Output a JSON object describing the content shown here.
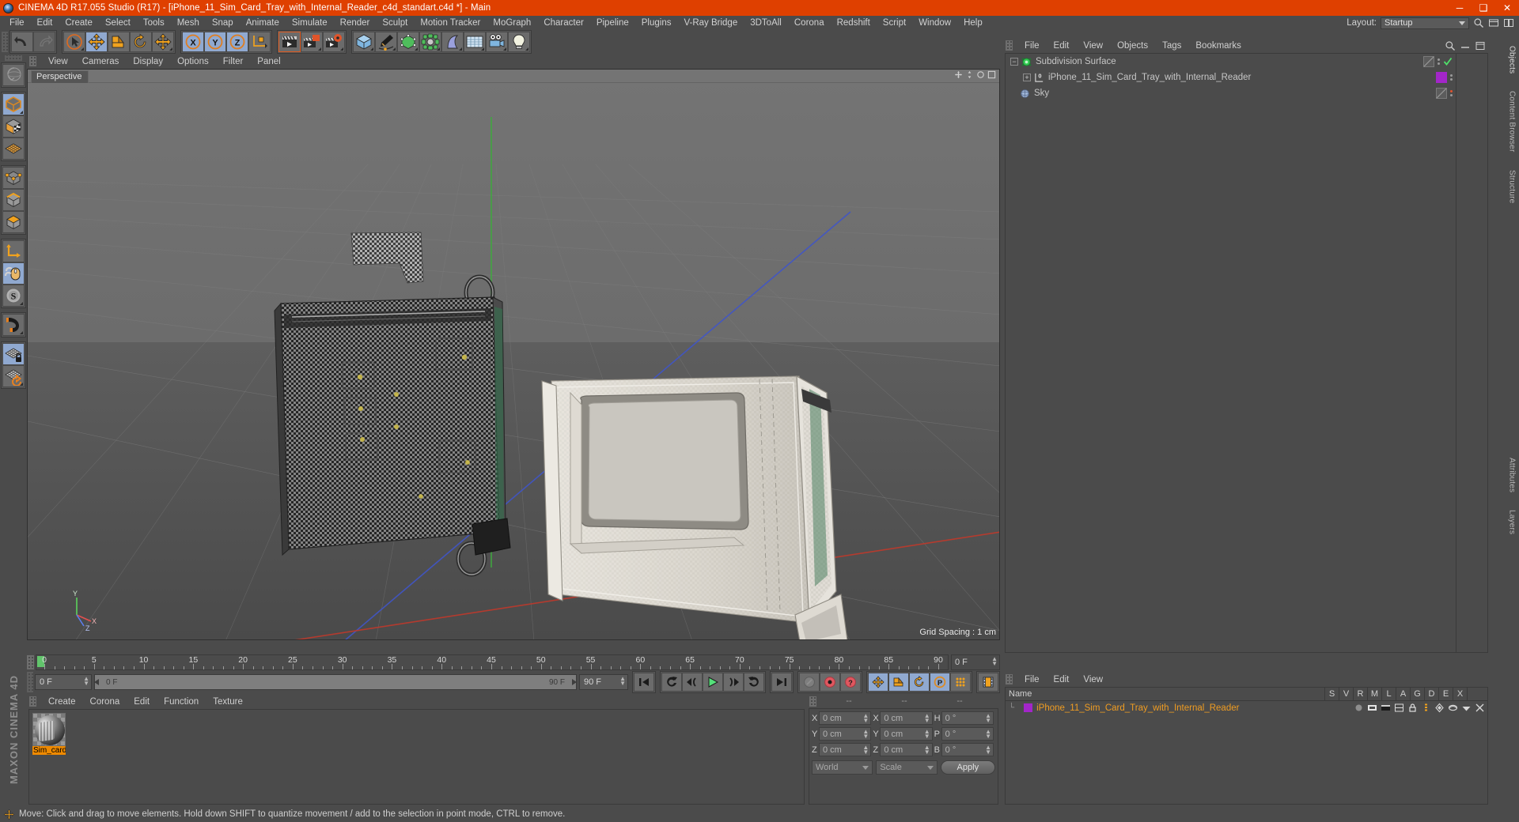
{
  "titlebar": {
    "title": "CINEMA 4D R17.055 Studio (R17) - [iPhone_11_Sim_Card_Tray_with_Internal_Reader_c4d_standart.c4d *] - Main",
    "minimize": "─",
    "maximize": "❑",
    "close": "✕",
    "accent_color": "#df4000"
  },
  "menubar": {
    "items": [
      {
        "label": "File"
      },
      {
        "label": "Edit"
      },
      {
        "label": "Create"
      },
      {
        "label": "Select"
      },
      {
        "label": "Tools"
      },
      {
        "label": "Mesh"
      },
      {
        "label": "Snap"
      },
      {
        "label": "Animate"
      },
      {
        "label": "Simulate"
      },
      {
        "label": "Render"
      },
      {
        "label": "Sculpt"
      },
      {
        "label": "Motion Tracker"
      },
      {
        "label": "MoGraph"
      },
      {
        "label": "Character"
      },
      {
        "label": "Pipeline"
      },
      {
        "label": "Plugins"
      },
      {
        "label": "V-Ray Bridge"
      },
      {
        "label": "3DToAll"
      },
      {
        "label": "Corona"
      },
      {
        "label": "Redshift"
      },
      {
        "label": "Script"
      },
      {
        "label": "Window"
      },
      {
        "label": "Help"
      }
    ],
    "layout_label": "Layout:",
    "layout_value": "Startup"
  },
  "toolbar": {
    "groups": [
      {
        "name": "history",
        "buttons": [
          {
            "icon": "undo-icon",
            "state": "normal"
          },
          {
            "icon": "redo-icon",
            "state": "disabled"
          }
        ]
      },
      {
        "name": "transform",
        "buttons": [
          {
            "icon": "select-cursor-icon",
            "state": "normal"
          },
          {
            "icon": "move-icon",
            "state": "active"
          },
          {
            "icon": "scale-icon",
            "state": "normal"
          },
          {
            "icon": "rotate-icon",
            "state": "normal"
          },
          {
            "icon": "move-alt-icon",
            "state": "normal"
          }
        ]
      },
      {
        "name": "axis-lock",
        "buttons": [
          {
            "icon": "axis-x-icon",
            "state": "active"
          },
          {
            "icon": "axis-y-icon",
            "state": "active"
          },
          {
            "icon": "axis-z-icon",
            "state": "active"
          },
          {
            "icon": "world-coordinate-icon",
            "state": "normal"
          }
        ]
      },
      {
        "name": "render",
        "buttons": [
          {
            "icon": "render-view-icon",
            "state": "selected"
          },
          {
            "icon": "render-picture-viewer-icon",
            "state": "normal"
          },
          {
            "icon": "render-settings-icon",
            "state": "normal"
          }
        ]
      },
      {
        "name": "objects",
        "buttons": [
          {
            "icon": "cube-primitive-icon",
            "state": "normal"
          },
          {
            "icon": "spline-pen-icon",
            "state": "normal"
          },
          {
            "icon": "generator-icon",
            "state": "normal"
          },
          {
            "icon": "mograph-cloner-icon",
            "state": "normal"
          },
          {
            "icon": "deformer-icon",
            "state": "normal"
          },
          {
            "icon": "scene-environment-icon",
            "state": "normal"
          },
          {
            "icon": "camera-icon",
            "state": "normal"
          },
          {
            "icon": "light-icon",
            "state": "normal"
          }
        ]
      }
    ]
  },
  "left_palette": {
    "groups": [
      {
        "buttons": [
          {
            "icon": "undo-view-icon",
            "state": "normal"
          }
        ]
      },
      {
        "buttons": [
          {
            "icon": "model-mode-icon",
            "state": "active"
          },
          {
            "icon": "texture-mode-icon",
            "state": "normal"
          },
          {
            "icon": "workplane-mode-icon",
            "state": "normal"
          }
        ]
      },
      {
        "buttons": [
          {
            "icon": "points-mode-icon",
            "state": "normal"
          },
          {
            "icon": "edges-mode-icon",
            "state": "normal"
          },
          {
            "icon": "polygons-mode-icon",
            "state": "normal"
          }
        ]
      },
      {
        "buttons": [
          {
            "icon": "object-axis-icon",
            "state": "normal"
          },
          {
            "icon": "viewport-solo-mouse-icon",
            "state": "active"
          },
          {
            "icon": "soft-selection-icon",
            "state": "normal"
          }
        ]
      },
      {
        "buttons": [
          {
            "icon": "magnet-icon",
            "state": "normal"
          }
        ]
      },
      {
        "buttons": [
          {
            "icon": "workplane-lock-icon",
            "state": "active"
          },
          {
            "icon": "workplane-rotate-icon",
            "state": "normal"
          }
        ]
      }
    ],
    "maxon_brand": "MAXON CINEMA 4D"
  },
  "viewport": {
    "menu": [
      {
        "label": "View"
      },
      {
        "label": "Cameras"
      },
      {
        "label": "Display"
      },
      {
        "label": "Options"
      },
      {
        "label": "Filter"
      },
      {
        "label": "Panel"
      }
    ],
    "tab_label": "Perspective",
    "grid_spacing": "Grid Spacing : 1 cm",
    "axis_labels": {
      "x": "X",
      "y": "Y",
      "z": "Z"
    },
    "colors": {
      "x_axis": "#c0392b",
      "y_axis": "#3aa03a",
      "z_axis": "#3b5fd0",
      "bg_top": "#717171",
      "bg_bottom": "#4c4c4c"
    }
  },
  "timeline": {
    "ticks": [
      {
        "label": "0",
        "value": 0
      },
      {
        "label": "5",
        "value": 5
      },
      {
        "label": "10",
        "value": 10
      },
      {
        "label": "15",
        "value": 15
      },
      {
        "label": "20",
        "value": 20
      },
      {
        "label": "25",
        "value": 25
      },
      {
        "label": "30",
        "value": 30
      },
      {
        "label": "35",
        "value": 35
      },
      {
        "label": "40",
        "value": 40
      },
      {
        "label": "45",
        "value": 45
      },
      {
        "label": "50",
        "value": 50
      },
      {
        "label": "55",
        "value": 55
      },
      {
        "label": "60",
        "value": 60
      },
      {
        "label": "65",
        "value": 65
      },
      {
        "label": "70",
        "value": 70
      },
      {
        "label": "75",
        "value": 75
      },
      {
        "label": "80",
        "value": 80
      },
      {
        "label": "85",
        "value": 85
      },
      {
        "label": "90",
        "value": 90
      }
    ],
    "current_frame_field": "0 F",
    "playhead_frame": 0
  },
  "animbar": {
    "current_frame": "0 F",
    "range_start": "0 F",
    "range_end": "90 F",
    "end_frame": "90 F",
    "transport": [
      {
        "icon": "go-to-start-icon"
      },
      {
        "icon": "previous-key-icon"
      },
      {
        "icon": "step-back-icon"
      },
      {
        "icon": "play-icon"
      },
      {
        "icon": "step-forward-icon"
      },
      {
        "icon": "next-key-icon"
      },
      {
        "icon": "go-to-end-icon"
      }
    ],
    "record": [
      {
        "icon": "autokey-off-icon"
      },
      {
        "icon": "record-active-objects-icon"
      },
      {
        "icon": "autokeying-icon"
      }
    ],
    "keytoggles": [
      {
        "icon": "key-position-icon",
        "state": "active"
      },
      {
        "icon": "key-scale-icon",
        "state": "active"
      },
      {
        "icon": "key-rotation-icon",
        "state": "active"
      },
      {
        "icon": "key-parameter-icon",
        "state": "active"
      },
      {
        "icon": "key-point-level-icon",
        "state": "normal"
      }
    ],
    "extra": [
      {
        "icon": "timeline-filmstrip-icon"
      }
    ]
  },
  "material_manager": {
    "menu": [
      {
        "label": "Create"
      },
      {
        "label": "Corona"
      },
      {
        "label": "Edit"
      },
      {
        "label": "Function"
      },
      {
        "label": "Texture"
      }
    ],
    "materials": [
      {
        "name": "Sim_card",
        "selected": true
      }
    ]
  },
  "coordinates": {
    "headers": [
      "--",
      "--",
      "--"
    ],
    "rows": [
      {
        "label1": "X",
        "value1": "0 cm",
        "label2": "X",
        "value2": "0 cm",
        "label3": "H",
        "value3": "0 °"
      },
      {
        "label1": "Y",
        "value1": "0 cm",
        "label2": "Y",
        "value2": "0 cm",
        "label3": "P",
        "value3": "0 °"
      },
      {
        "label1": "Z",
        "value1": "0 cm",
        "label2": "Z",
        "value2": "0 cm",
        "label3": "B",
        "value3": "0 °"
      }
    ],
    "system": "World",
    "mode": "Scale",
    "apply": "Apply"
  },
  "object_manager": {
    "menu": [
      {
        "label": "File"
      },
      {
        "label": "Edit"
      },
      {
        "label": "View"
      },
      {
        "label": "Objects"
      },
      {
        "label": "Tags"
      },
      {
        "label": "Bookmarks"
      }
    ],
    "objects": [
      {
        "name": "Subdivision Surface",
        "icon": "subdivision-surface-icon",
        "indent": 0,
        "expander": "−",
        "has_check": true,
        "material_color": null
      },
      {
        "name": "iPhone_11_Sim_Card_Tray_with_Internal_Reader",
        "icon": "polygon-object-icon",
        "indent": 1,
        "expander": "+",
        "has_check": false,
        "material_color": "#a326c9"
      },
      {
        "name": "Sky",
        "icon": "sky-object-icon",
        "indent": 0,
        "expander": "",
        "has_check": false,
        "material_color": null,
        "dot_color": "#e0522e"
      }
    ],
    "search_icon": "search-icon"
  },
  "structure_manager": {
    "menu": [
      {
        "label": "File"
      },
      {
        "label": "Edit"
      },
      {
        "label": "View"
      }
    ],
    "columns": [
      "Name",
      "S",
      "V",
      "R",
      "M",
      "L",
      "A",
      "G",
      "D",
      "E",
      "X"
    ],
    "rows": [
      {
        "name": "iPhone_11_Sim_Card_Tray_with_Internal_Reader",
        "swatch": "#a326c9"
      }
    ]
  },
  "right_tabs": [
    {
      "label": "Objects"
    },
    {
      "label": "Content Browser"
    },
    {
      "label": "Structure"
    },
    {
      "label": "Attributes"
    },
    {
      "label": "Layers"
    }
  ],
  "status": {
    "icon": "move-tool-icon",
    "text": "Move: Click and drag to move elements. Hold down SHIFT to quantize movement / add to the selection in point mode, CTRL to remove."
  }
}
